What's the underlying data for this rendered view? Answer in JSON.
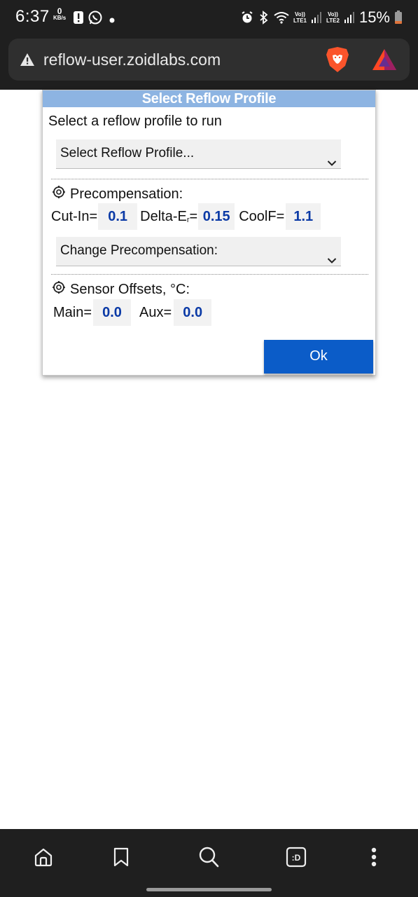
{
  "status_bar": {
    "time": "6:37",
    "net_speed_value": "0",
    "net_speed_unit": "KB/s",
    "battery_percent": "15%",
    "lte1_label_top": "Vo))",
    "lte1_label_bottom": "LTE1",
    "lte2_label_top": "Vo))",
    "lte2_label_bottom": "LTE2",
    "notification_icons": [
      "alert-icon",
      "whatsapp-icon",
      "dot-icon"
    ],
    "system_icons": [
      "alarm-icon",
      "bluetooth-icon",
      "wifi-icon",
      "signal-icon",
      "battery-icon"
    ]
  },
  "browser": {
    "url": "reflow-user.zoidlabs.com",
    "security_icon": "warning-icon",
    "shield_icon": "brave-shields-icon",
    "rewards_icon": "brave-rewards-icon"
  },
  "dialog": {
    "title": "Select Reflow Profile",
    "subtitle": "Select a reflow profile to run",
    "profile_select": "Select Reflow Profile...",
    "precomp": {
      "heading": "Precompensation:",
      "cutin_label": "Cut-In=",
      "cutin_value": "0.1",
      "delta_label_main": "Delta-E",
      "delta_label_sub": "r",
      "delta_label_eq": "=",
      "delta_value": "0.15",
      "coolf_label": "CoolF=",
      "coolf_value": "1.1",
      "change_select": "Change Precompensation:"
    },
    "offsets": {
      "heading": "Sensor Offsets, °C:",
      "main_label": "Main=",
      "main_value": "0.0",
      "aux_label": "Aux=",
      "aux_value": "0.0"
    },
    "ok_label": "Ok"
  },
  "bottom_nav": {
    "items": [
      "home-icon",
      "bookmark-icon",
      "search-icon",
      "tabs-icon",
      "more-icon"
    ],
    "tabs_label": ":D"
  },
  "colors": {
    "title_bar": "#8db4e2",
    "ok_button": "#0b5cc8",
    "value_text": "#0b3aa6",
    "chrome_dark": "#1f1f1f"
  }
}
